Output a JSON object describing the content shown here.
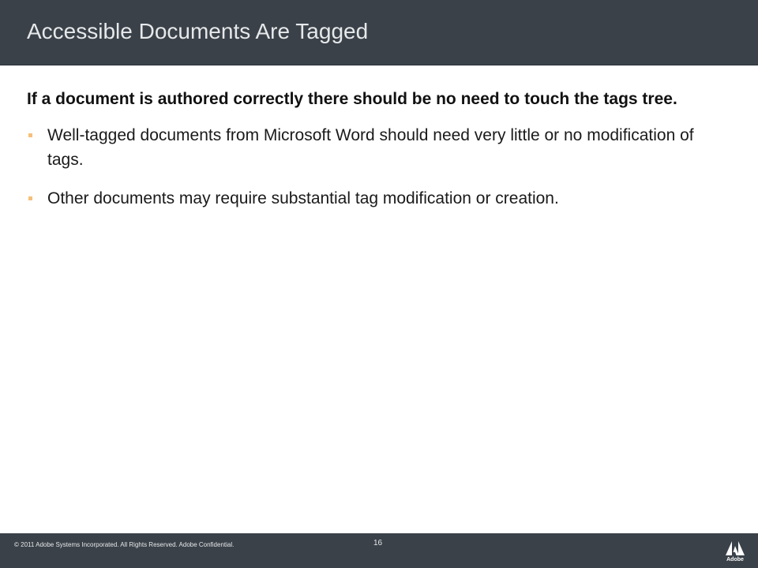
{
  "slide": {
    "title": "Accessible Documents Are Tagged",
    "lead": "If a document is authored correctly there should be no need to touch the tags tree.",
    "bullets": [
      "Well-tagged documents from Microsoft Word should need very little or no modification of tags.",
      "Other documents may require substantial tag modification or creation."
    ]
  },
  "footer": {
    "copyright": "© 2011 Adobe Systems Incorporated.  All Rights Reserved.  Adobe Confidential.",
    "page_number": "16",
    "logo_text": "Adobe",
    "logo_icon": "adobe-logo-icon"
  },
  "colors": {
    "bar_background": "#3a4149",
    "title_text": "#e6e8ea",
    "bullet_marker": "#f5c07a",
    "body_text": "#1a1a1a"
  }
}
